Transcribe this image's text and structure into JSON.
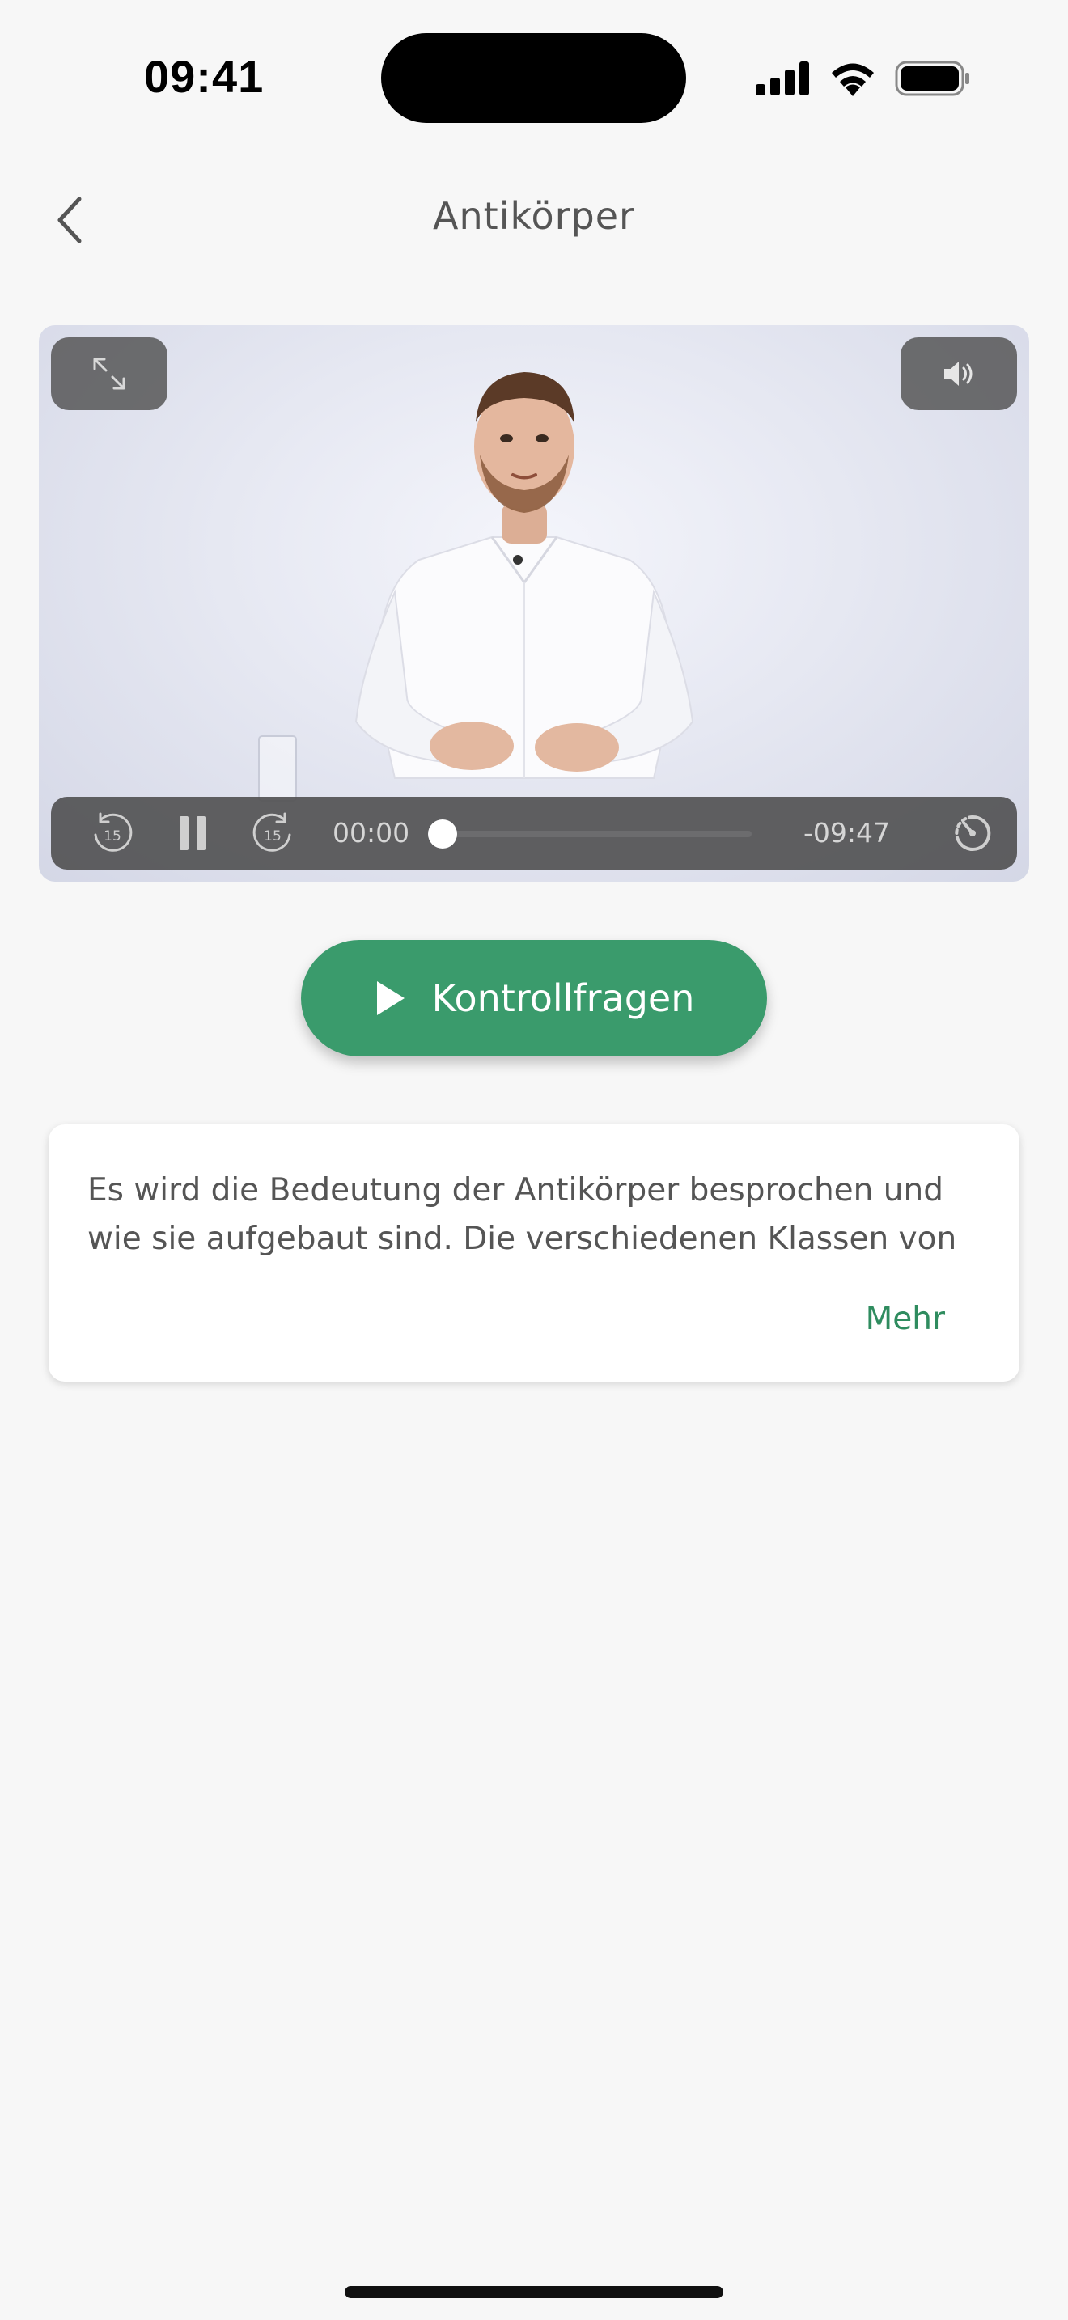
{
  "status_bar": {
    "time": "09:41",
    "icons": [
      "cellular-signal-icon",
      "wifi-icon",
      "battery-icon"
    ]
  },
  "nav": {
    "title": "Antikörper",
    "back_icon": "chevron-left-icon"
  },
  "video": {
    "top_left_icon": "expand-icon",
    "top_right_icon": "speaker-icon",
    "controls": {
      "rewind_label": "15",
      "forward_label": "15",
      "elapsed": "00:00",
      "remaining": "-09:47",
      "progress": 0.0,
      "state": "playing",
      "icons": [
        "rewind-15-icon",
        "pause-icon",
        "forward-15-icon",
        "playback-speed-icon"
      ]
    }
  },
  "cta": {
    "label": "Kontrollfragen",
    "icon": "play-icon"
  },
  "description": {
    "text": "Es wird die Bedeutung der Antikörper besprochen und wie sie aufgebaut sind. Die verschiedenen Klassen von",
    "more_label": "Mehr"
  },
  "colors": {
    "background": "#f7f7f7",
    "accent_green": "#3a9b6c",
    "link_green": "#2f8c5f",
    "controls_bg": "#525254"
  }
}
